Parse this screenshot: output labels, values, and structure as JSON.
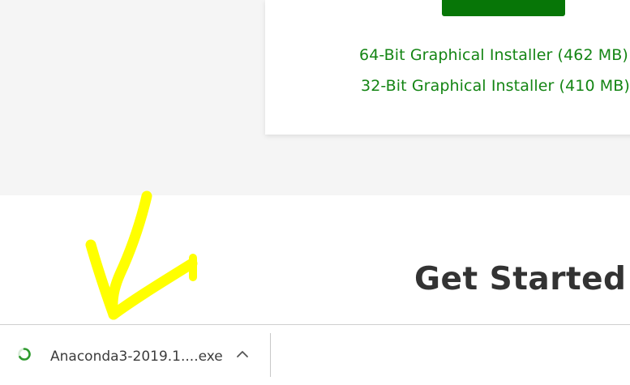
{
  "installers": {
    "link_64": "64-Bit Graphical Installer (462 MB)",
    "link_32": "32-Bit Graphical Installer (410 MB)"
  },
  "section": {
    "title": "Get Started with Anaconda"
  },
  "download_bar": {
    "file_name": "Anaconda3-2019.1....exe",
    "status_icon": "loading-spinner-icon",
    "menu_icon": "chevron-up-icon"
  },
  "colors": {
    "brand_green": "#077607",
    "link_green": "#148514",
    "highlight_yellow": "#ffff00"
  }
}
